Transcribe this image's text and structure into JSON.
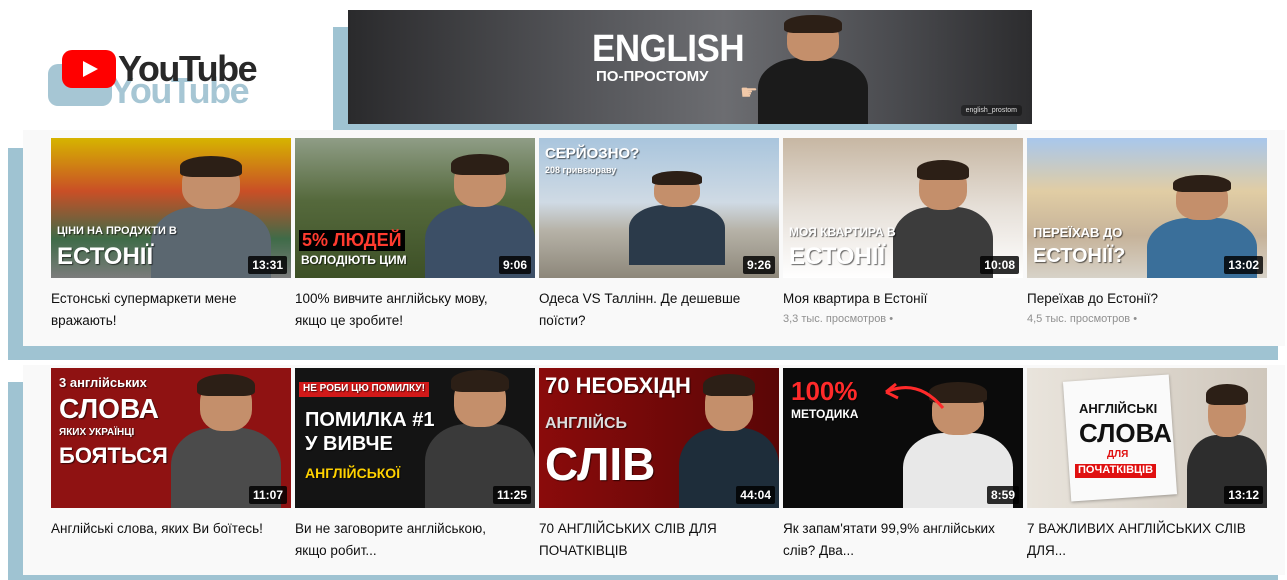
{
  "logo": {
    "text": "YouTube",
    "shadow_text": "YouTube"
  },
  "banner": {
    "title": "ENGLISH",
    "subtitle": "ПО-ПРОСТОМУ",
    "handle": "english_prostom"
  },
  "shelves": [
    {
      "videos": [
        {
          "title": "Естонські супермаркети мене вражають!",
          "duration": "13:31",
          "thumb_lines": [
            "ЦІНИ НА ПРОДУКТИ В",
            "ЕСТОНІЇ"
          ],
          "views": ""
        },
        {
          "title": "100% вивчите англійську мову, якщо це зробите!",
          "duration": "9:06",
          "thumb_lines": [
            "5% ЛЮДЕЙ",
            "ВОЛОДІЮТЬ ЦИМ"
          ],
          "views": ""
        },
        {
          "title": "Одеса VS Таллінн. Де дешевше поїсти?",
          "duration": "9:26",
          "thumb_lines": [
            "СЕРЙОЗНО?",
            "208 гривєюраву"
          ],
          "views": ""
        },
        {
          "title": "Моя квартира в Естонії",
          "duration": "10:08",
          "thumb_lines": [
            "МОЯ КВАРТИРА В",
            "ЕСТОНІЇ"
          ],
          "views": "3,3 тыс. просмотров •"
        },
        {
          "title": "Переїхав до Естонії?",
          "duration": "13:02",
          "thumb_lines": [
            "ПЕРЕЇХАВ ДО",
            "ЕСТОНІЇ?"
          ],
          "views": "4,5 тыс. просмотров •"
        }
      ]
    },
    {
      "videos": [
        {
          "title": "Англійські слова, яких Ви боїтесь!",
          "duration": "11:07",
          "thumb_lines": [
            "3 англійських",
            "СЛОВА",
            "ЯКИХ УКРАЇНЦІ",
            "БОЯТЬСЯ"
          ],
          "views": ""
        },
        {
          "title": "Ви не заговорите англійською, якщо робит...",
          "duration": "11:25",
          "thumb_lines": [
            "НЕ РОБИ ЦЮ ПОМИЛКУ!",
            "ПОМИЛКА #1",
            "У ВИВЧЕ",
            "АНГЛІЙСЬКОЇ"
          ],
          "views": ""
        },
        {
          "title": "70 АНГЛІЙСЬКИХ СЛІВ ДЛЯ ПОЧАТКІВЦІВ",
          "duration": "44:04",
          "thumb_lines": [
            "70 НЕОБХІДН",
            "АНГЛІЙСЬ",
            "СЛІВ"
          ],
          "views": ""
        },
        {
          "title": "Як запам'ятати 99,9% англійських слів? Два...",
          "duration": "8:59",
          "thumb_lines": [
            "100%",
            "МЕТОДИКА"
          ],
          "views": ""
        },
        {
          "title": "7 ВАЖЛИВИХ АНГЛІЙСЬКИХ СЛІВ ДЛЯ...",
          "duration": "13:12",
          "thumb_lines": [
            "АНГЛІЙСЬКІ",
            "СЛОВА",
            "ДЛЯ",
            "ПОЧАТКІВЦІВ"
          ],
          "views": ""
        }
      ]
    }
  ]
}
